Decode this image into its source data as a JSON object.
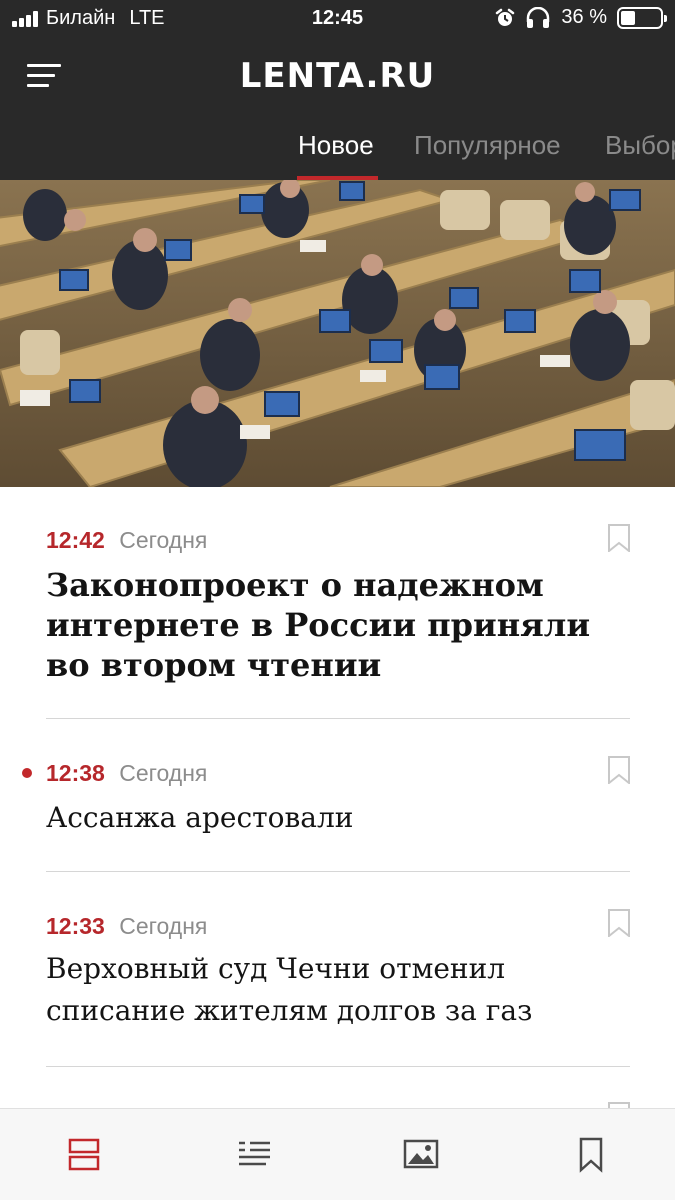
{
  "status_bar": {
    "carrier": "Билайн",
    "network": "LTE",
    "time": "12:45",
    "battery": "36 %",
    "battery_level": 0.36,
    "icons": [
      "signal-icon",
      "alarm-icon",
      "headphones-icon",
      "battery-icon"
    ]
  },
  "header": {
    "logo": "LENTA.RU",
    "menu_icon": "hamburger-icon"
  },
  "tabs": [
    {
      "label": "Новое",
      "active": true
    },
    {
      "label": "Популярное",
      "active": false
    },
    {
      "label": "Выбор",
      "active": false
    }
  ],
  "hero": {
    "image": "photo of State Duma deputies seated at desks with laptops"
  },
  "news": [
    {
      "time": "12:42",
      "date": "Сегодня",
      "title": "Законопроект о надежном интернете в России приняли во втором чтении",
      "featured": true,
      "unread": false
    },
    {
      "time": "12:38",
      "date": "Сегодня",
      "title": "Ассанжа арестовали",
      "featured": false,
      "unread": true
    },
    {
      "time": "12:33",
      "date": "Сегодня",
      "title": "Верховный суд Чечни отменил списание жителям долгов за газ",
      "featured": false,
      "unread": false
    }
  ],
  "bottom_nav": [
    {
      "icon": "feed-icon",
      "active": true
    },
    {
      "icon": "news-list-icon",
      "active": false
    },
    {
      "icon": "gallery-icon",
      "active": false
    },
    {
      "icon": "bookmarks-icon",
      "active": false
    }
  ],
  "colors": {
    "accent": "#c2282b",
    "header_bg": "#292929",
    "time_red": "#b6272b"
  }
}
